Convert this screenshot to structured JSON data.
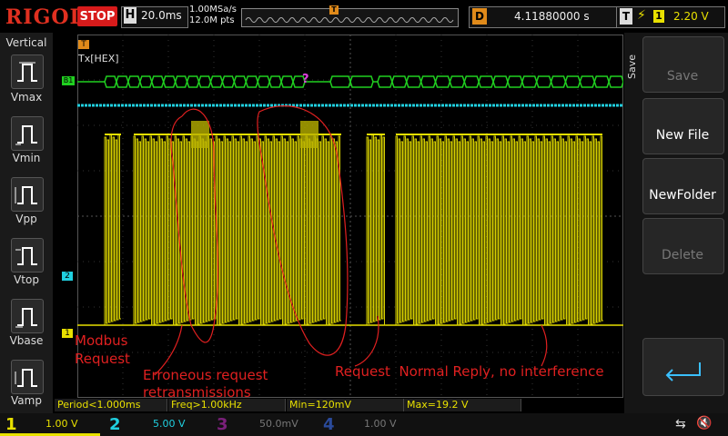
{
  "header": {
    "brand": "RIGOL",
    "run_state": "STOP",
    "timebase_prefix": "H",
    "timebase": "20.0ms",
    "sample_rate": "1.00MSa/s",
    "memory_depth": "12.0M pts",
    "delay_prefix": "D",
    "delay": "4.11880000 s",
    "trigger_prefix": "T",
    "trigger_channel": "1",
    "trigger_level": "2.20 V",
    "memory_marker": "T"
  },
  "left_panel": {
    "title": "Vertical",
    "items": [
      {
        "label": "Vmax"
      },
      {
        "label": "Vmin"
      },
      {
        "label": "Vpp"
      },
      {
        "label": "Vtop"
      },
      {
        "label": "Vbase"
      },
      {
        "label": "Vamp"
      }
    ]
  },
  "right_panel": {
    "menu_title": "Save",
    "buttons": [
      {
        "label": "Save",
        "enabled": false
      },
      {
        "label": "New File",
        "enabled": true
      },
      {
        "label": "NewFolder",
        "enabled": true
      },
      {
        "label": "Delete",
        "enabled": false
      }
    ],
    "enter_icon": "return-arrow-icon"
  },
  "display": {
    "decoder_label": "Tx[HEX]",
    "bus_marker": "B1",
    "decode_error": "?",
    "ch1_marker": "1",
    "ch2_marker": "2",
    "trigger_marker": "T",
    "annotations": {
      "modbus_request": "Modbus\nRequest",
      "erroneous": "Erroneous request\nretransmissions",
      "normal": "Request  Normal Reply, no interference"
    }
  },
  "measurements": [
    {
      "text": "Period<1.000ms"
    },
    {
      "text": "Freq>1.00kHz"
    },
    {
      "text": "Min=120mV"
    },
    {
      "text": "Max=19.2 V"
    }
  ],
  "channels": [
    {
      "num": "1",
      "scale": "1.00 V",
      "color": "#e8e000"
    },
    {
      "num": "2",
      "scale": "5.00 V",
      "color": "#20d0e0"
    },
    {
      "num": "3",
      "scale": "50.0mV",
      "color": "#b020c0"
    },
    {
      "num": "4",
      "scale": "1.00 V",
      "color": "#2060e0"
    }
  ],
  "status_icons": [
    "usb-icon",
    "speaker-mute-icon"
  ],
  "colors": {
    "ch1": "#e8e000",
    "ch2": "#20d0e0",
    "bus": "#20d020",
    "annotation": "#e02020",
    "stop": "#d81b1b"
  }
}
